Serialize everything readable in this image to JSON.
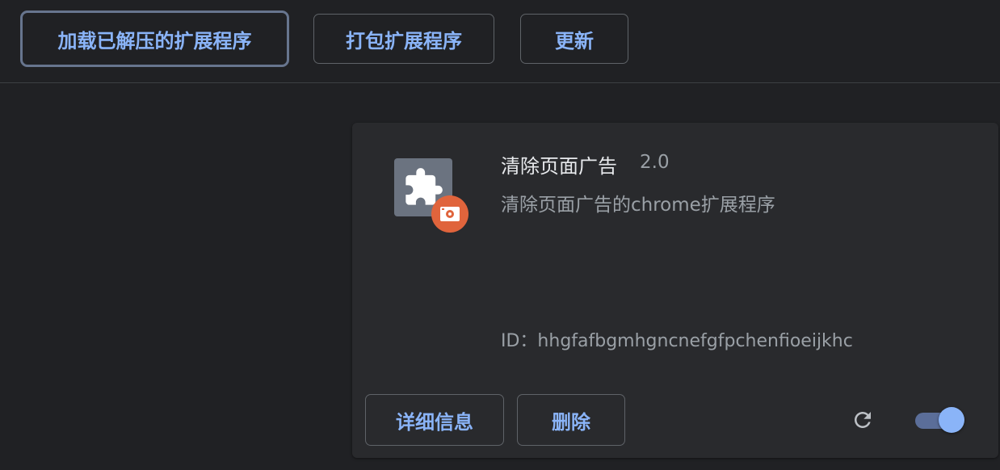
{
  "toolbar": {
    "load_unpacked_label": "加载已解压的扩展程序",
    "pack_label": "打包扩展程序",
    "update_label": "更新"
  },
  "extension": {
    "name": "清除页面广告",
    "version": "2.0",
    "description": "清除页面广告的chrome扩展程序",
    "id_line": "ID：hhgfafbgmhgncnefgfpchenfioeijkhc",
    "details_label": "详细信息",
    "remove_label": "删除",
    "enabled": true,
    "icon": "puzzle-piece-icon",
    "badge_icon": "unpacked-source-icon",
    "reload_icon": "reload-icon"
  },
  "colors": {
    "background": "#202124",
    "card": "#292a2d",
    "accent": "#8ab4f8",
    "badge": "#e0643c"
  }
}
